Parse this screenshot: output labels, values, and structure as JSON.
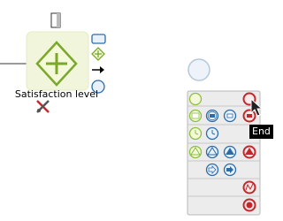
{
  "gateway": {
    "label": "Satisfaction level",
    "type": "parallel-gateway"
  },
  "context_pad": {
    "items": [
      "task-icon",
      "gateway-icon",
      "connect-arrow-icon",
      "end-event-icon"
    ]
  },
  "tooltip": {
    "text": "End"
  },
  "palette": {
    "rows": [
      [
        "start-event",
        "end-event"
      ],
      [
        "message-start",
        "message-catch",
        "message-intermediate",
        "message-end"
      ],
      [
        "timer-start",
        "timer-intermediate"
      ],
      [
        "signal-start",
        "signal-catch",
        "signal-throw",
        "signal-end"
      ],
      [
        "link-catch",
        "link-throw"
      ],
      [
        "error-end"
      ],
      [
        "terminate-end"
      ]
    ]
  },
  "colors": {
    "gateway_fill": "#f0f6d8",
    "gateway_stroke": "#7aa82a",
    "start_green": "#8bbf3f",
    "message_blue": "#2d6ca6",
    "signal_red": "#c3272b",
    "palette_bg": "#ececec"
  }
}
